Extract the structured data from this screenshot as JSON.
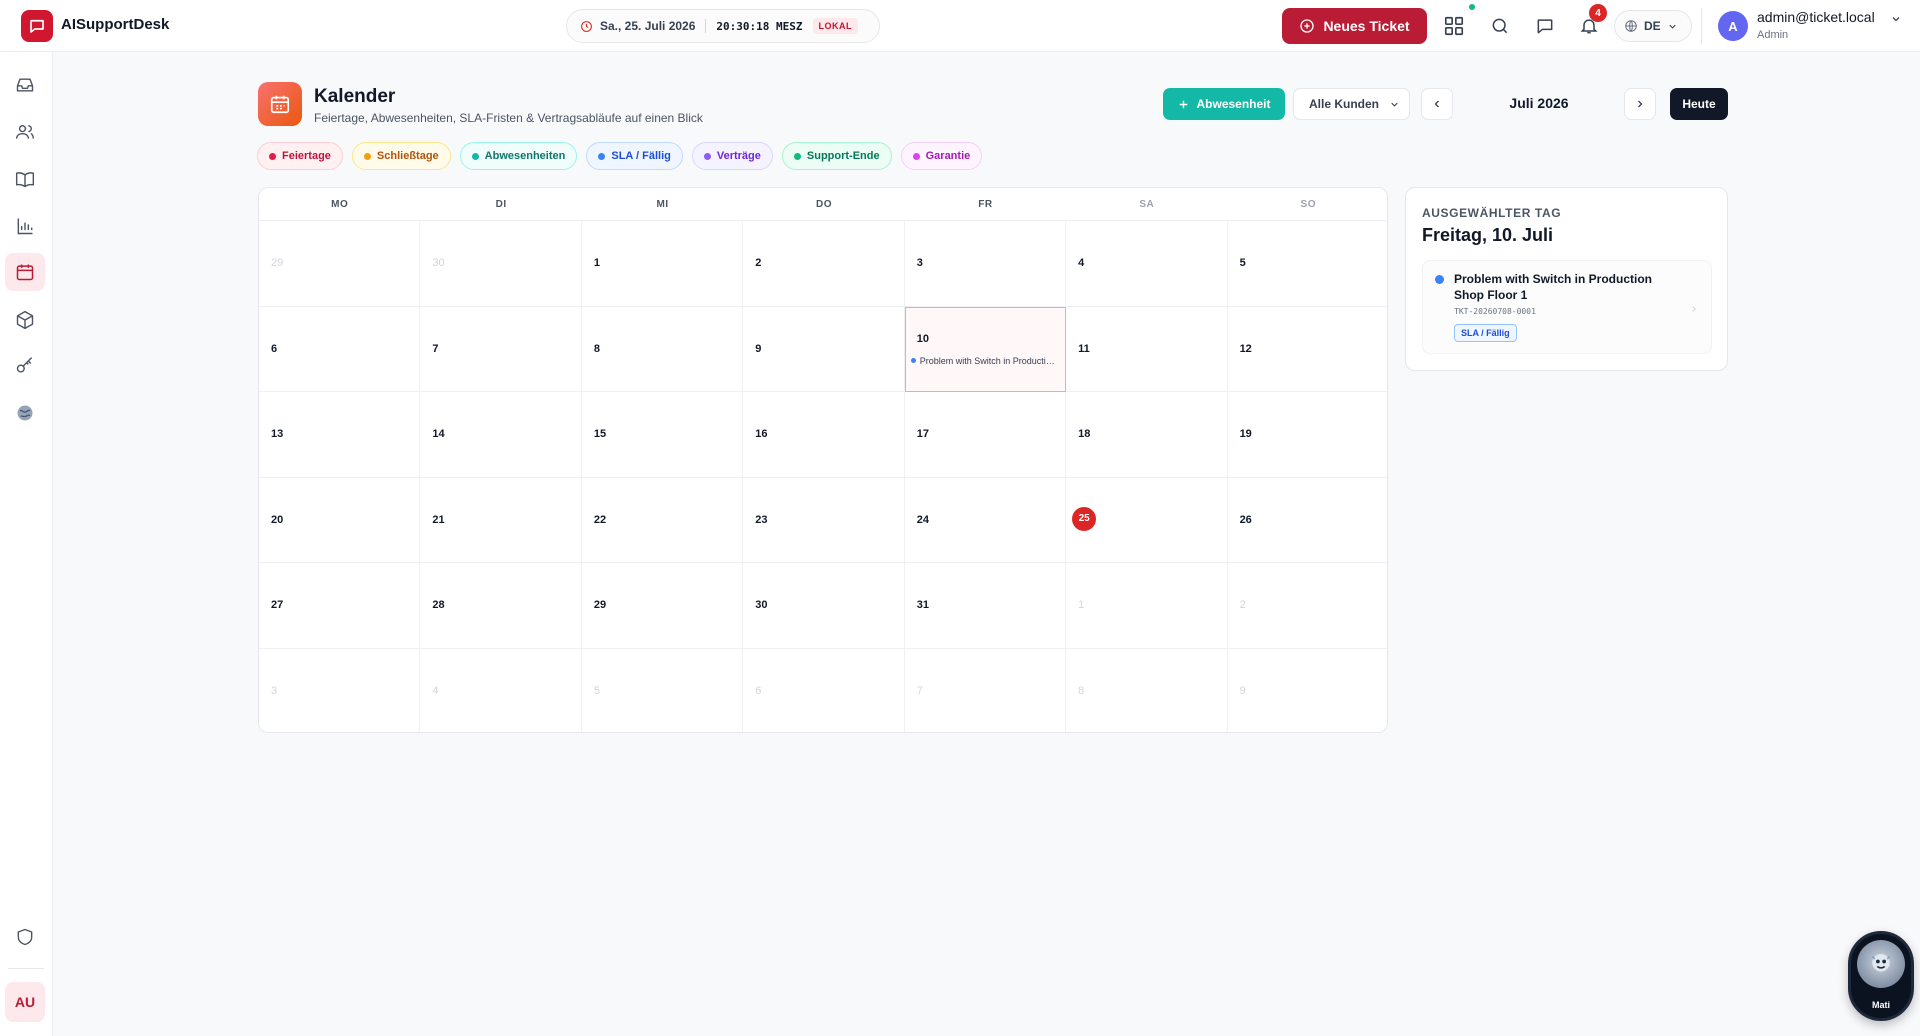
{
  "app": {
    "name": "AISupportDesk"
  },
  "clock": {
    "date": "Sa., 25. Juli 2026",
    "time": "20:30:18 MESZ",
    "badge": "LOKAL"
  },
  "topbar": {
    "new_ticket_label": "Neues Ticket",
    "notification_count": "4",
    "language": "DE"
  },
  "user": {
    "email": "admin@ticket.local",
    "role": "Admin",
    "avatar_initial": "A"
  },
  "sidebar": {
    "items": [
      {
        "name": "inbox-icon"
      },
      {
        "name": "users-icon"
      },
      {
        "name": "book-icon"
      },
      {
        "name": "chart-icon"
      },
      {
        "name": "calendar-icon",
        "active": true
      },
      {
        "name": "package-icon"
      },
      {
        "name": "key-icon"
      },
      {
        "name": "globe-icon"
      }
    ],
    "bottom_avatar": "AU"
  },
  "page": {
    "title": "Kalender",
    "subtitle": "Feiertage, Abwesenheiten, SLA-Fristen & Vertragsabläufe auf einen Blick",
    "add_absence_label": "Abwesenheit",
    "customer_filter": "Alle Kunden",
    "month_label": "Juli 2026",
    "today_label": "Heute"
  },
  "legend": [
    {
      "label": "Feiertage",
      "color": "#e11d48",
      "bg": "#fff1f2",
      "border": "#fecdd3",
      "text": "#be123c"
    },
    {
      "label": "Schließtage",
      "color": "#f59e0b",
      "bg": "#fffbeb",
      "border": "#fde68a",
      "text": "#b45309"
    },
    {
      "label": "Abwesenheiten",
      "color": "#14b8a6",
      "bg": "#f0fdfa",
      "border": "#99f6e4",
      "text": "#0f766e"
    },
    {
      "label": "SLA / Fällig",
      "color": "#3b82f6",
      "bg": "#eff6ff",
      "border": "#bfdbfe",
      "text": "#1d4ed8"
    },
    {
      "label": "Verträge",
      "color": "#8b5cf6",
      "bg": "#f5f3ff",
      "border": "#ddd6fe",
      "text": "#6d28d9"
    },
    {
      "label": "Support-Ende",
      "color": "#10b981",
      "bg": "#ecfdf5",
      "border": "#a7f3d0",
      "text": "#047857"
    },
    {
      "label": "Garantie",
      "color": "#d946ef",
      "bg": "#fdf4ff",
      "border": "#f5d0fe",
      "text": "#a21caf"
    }
  ],
  "calendar": {
    "weekdays": [
      "MO",
      "DI",
      "MI",
      "DO",
      "FR",
      "SA",
      "SO"
    ],
    "days": [
      {
        "d": "29",
        "out": true
      },
      {
        "d": "30",
        "out": true
      },
      {
        "d": "1"
      },
      {
        "d": "2"
      },
      {
        "d": "3"
      },
      {
        "d": "4"
      },
      {
        "d": "5"
      },
      {
        "d": "6"
      },
      {
        "d": "7"
      },
      {
        "d": "8"
      },
      {
        "d": "9"
      },
      {
        "d": "10",
        "selected": true,
        "event": "Problem with Switch in Production Shop Floor 1"
      },
      {
        "d": "11"
      },
      {
        "d": "12"
      },
      {
        "d": "13"
      },
      {
        "d": "14"
      },
      {
        "d": "15"
      },
      {
        "d": "16"
      },
      {
        "d": "17"
      },
      {
        "d": "18"
      },
      {
        "d": "19"
      },
      {
        "d": "20"
      },
      {
        "d": "21"
      },
      {
        "d": "22"
      },
      {
        "d": "23"
      },
      {
        "d": "24"
      },
      {
        "d": "25",
        "today": true
      },
      {
        "d": "26"
      },
      {
        "d": "27"
      },
      {
        "d": "28"
      },
      {
        "d": "29"
      },
      {
        "d": "30"
      },
      {
        "d": "31"
      },
      {
        "d": "1",
        "out": true
      },
      {
        "d": "2",
        "out": true
      },
      {
        "d": "3",
        "out": true
      },
      {
        "d": "4",
        "out": true
      },
      {
        "d": "5",
        "out": true
      },
      {
        "d": "6",
        "out": true
      },
      {
        "d": "7",
        "out": true
      },
      {
        "d": "8",
        "out": true
      },
      {
        "d": "9",
        "out": true
      }
    ]
  },
  "selected_day": {
    "label": "AUSGEWÄHLTER TAG",
    "date": "Freitag, 10. Juli",
    "event": {
      "title": "Problem with Switch in Production Shop Floor 1",
      "ticket_id": "TKT-20260708-0001",
      "tag": "SLA / Fällig"
    }
  },
  "assistant": {
    "name": "Mati"
  }
}
